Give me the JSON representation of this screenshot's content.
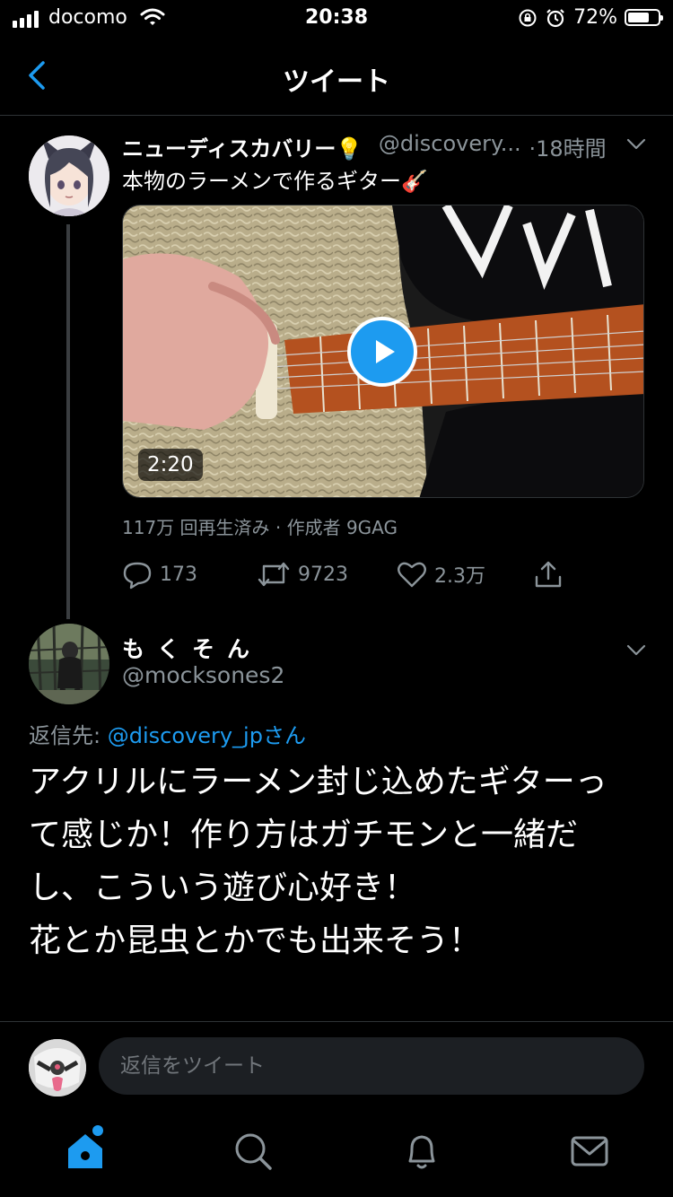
{
  "status_bar": {
    "carrier": "docomo",
    "time": "20:38",
    "battery_percent": "72%",
    "battery_level": 0.72
  },
  "header": {
    "title": "ツイート"
  },
  "tweet": {
    "name": "ニューディスカバリー💡",
    "handle": "@discovery...",
    "time": "·18時間",
    "text": "本物のラーメンで作るギター🎸",
    "video": {
      "duration": "2:20",
      "views": "117万 回再生済み · 作成者 9GAG"
    },
    "actions": {
      "replies": "173",
      "retweets": "9723",
      "likes": "2.3万"
    }
  },
  "reply": {
    "name": "もくそん",
    "handle": "@mocksones2",
    "reply_to_prefix": "返信先: ",
    "reply_to_mention": "@discovery_jpさん",
    "text_lines": [
      "アクリルにラーメン封じ込めたギターっ",
      "て感じか！作り方はガチモンと一緒だ",
      "し、こういう遊び心好き！",
      "花とか昆虫とかでも出来そう！"
    ]
  },
  "composer": {
    "placeholder": "返信をツイート"
  },
  "tab_bar": {
    "items": [
      "home-icon",
      "search-icon",
      "notifications-icon",
      "messages-icon"
    ],
    "accent": "#1d9bf0"
  },
  "colors": {
    "background": "#000000",
    "accent": "#1d9bf0",
    "secondary_text": "#8b949a"
  }
}
